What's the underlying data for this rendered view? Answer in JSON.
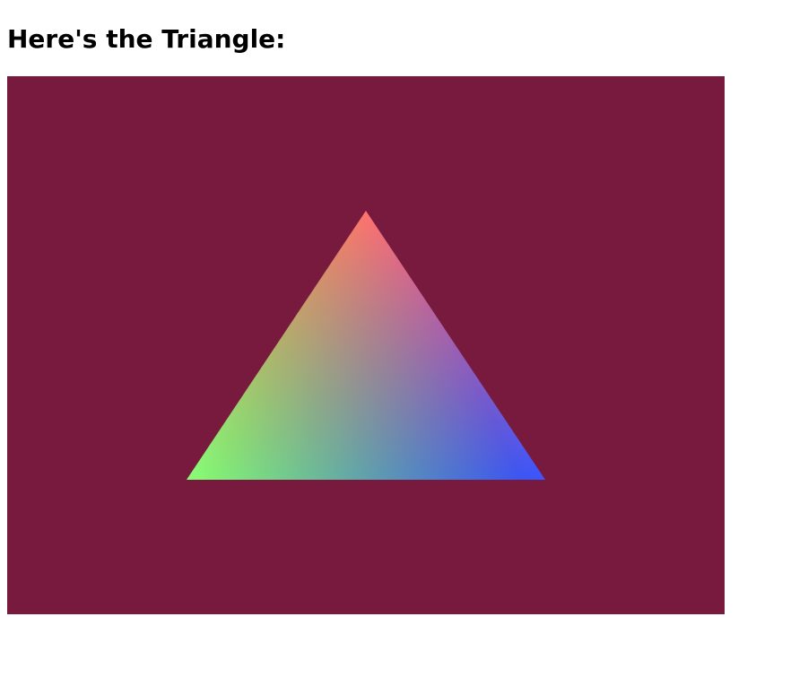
{
  "page": {
    "title": "Here's the Triangle:"
  },
  "canvas": {
    "clear_color": "#781a3e",
    "vertex_colors": {
      "top": "#ff2a10",
      "bottom_left": "#66ff33",
      "bottom_right": "#0010ff"
    }
  }
}
